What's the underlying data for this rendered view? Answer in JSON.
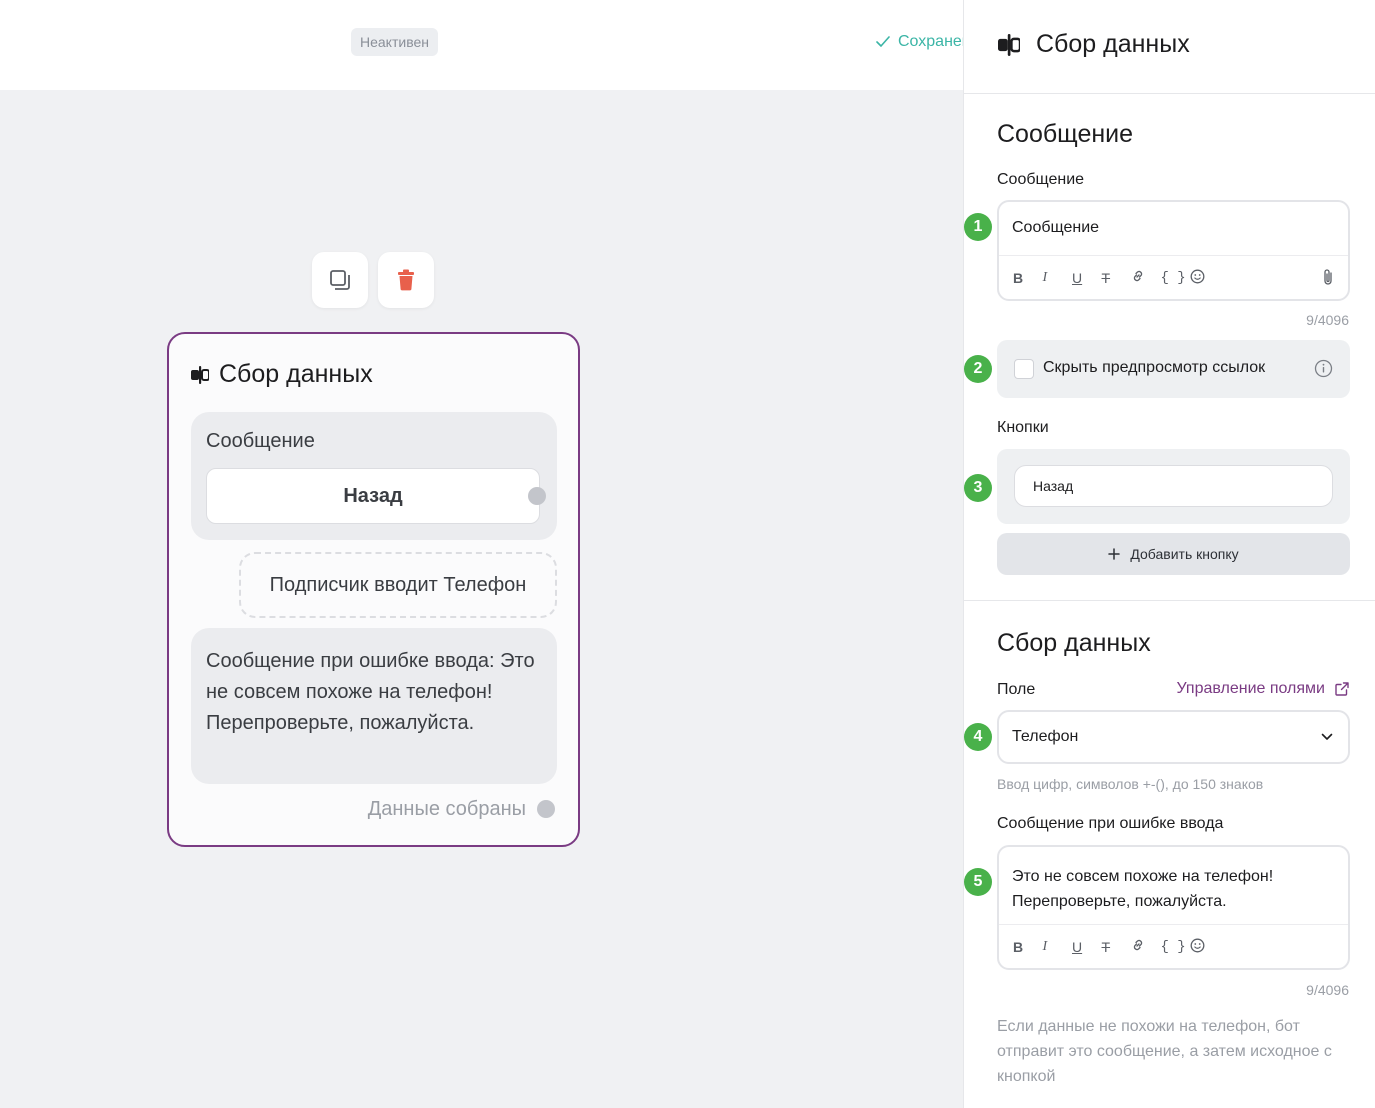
{
  "topbar": {
    "status": "Неактивен",
    "saved": "Сохранено"
  },
  "canvas": {
    "node": {
      "title": "Сбор данных",
      "message_label": "Сообщение",
      "back_button": "Назад",
      "input_text": "Подписчик вводит Телефон",
      "error_text": "Сообщение при ошибке ввода: Это не совсем похоже на телефон! Перепроверьте, пожалуйста.",
      "collected_label": "Данные собраны"
    }
  },
  "panel": {
    "title": "Сбор данных",
    "message_section": {
      "heading": "Сообщение",
      "field_label": "Сообщение",
      "field_value": "Сообщение",
      "counter": "9/4096",
      "toolbar": [
        "B",
        "I",
        "U",
        "T",
        "link",
        "{ }",
        "emoji"
      ],
      "hide_preview_label": "Скрыть предпросмотр ссылок",
      "hide_preview_checked": false,
      "buttons_label": "Кнопки",
      "buttons": [
        "Назад"
      ],
      "add_button": "Добавить кнопку"
    },
    "data_section": {
      "heading": "Сбор данных",
      "field_label": "Поле",
      "manage_link": "Управление полями",
      "field_value": "Телефон",
      "field_hint": "Ввод цифр, символов +-(), до 150 знаков",
      "error_label": "Сообщение при ошибке ввода",
      "error_value_line1": "Это не совсем похоже на телефон!",
      "error_value_line2": "Перепроверьте, пожалуйста.",
      "counter": "9/4096",
      "footer_hint": "Если данные не похожи на телефон, бот отправит это сообщение, а затем исходное с кнопкой"
    },
    "step_badges": [
      "1",
      "2",
      "3",
      "4",
      "5"
    ]
  },
  "colors": {
    "accent": "#7a3b83",
    "success": "#3bb5a6",
    "badge": "#49b14a",
    "danger": "#e8604c"
  }
}
